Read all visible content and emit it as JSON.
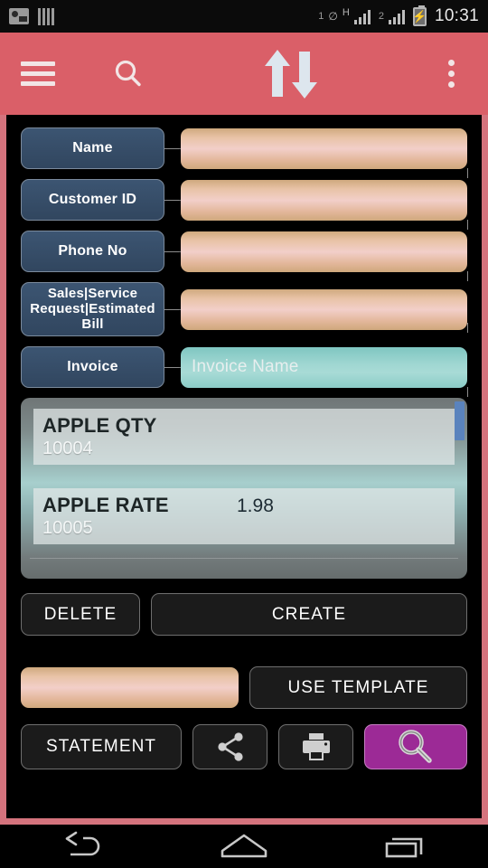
{
  "status_bar": {
    "left_icons": [
      "photo-icon",
      "bars-icon"
    ],
    "sim1_label": "1",
    "network_type": "H",
    "sim2_label": "2",
    "battery_icon": "battery-charging-icon",
    "time": "10:31"
  },
  "app_bar": {
    "background": "#da5f68",
    "menu_icon": "hamburger-menu-icon",
    "search_icon": "search-icon",
    "logo_icon": "sync-arrows-icon",
    "overflow_icon": "overflow-menu-icon"
  },
  "form": {
    "accent_border": "#d4737d",
    "fields": [
      {
        "label": "Name",
        "value": "",
        "placeholder": "",
        "style": "tan",
        "two_line": false
      },
      {
        "label": "Customer ID",
        "value": "",
        "placeholder": "",
        "style": "tan",
        "two_line": false
      },
      {
        "label": "Phone No",
        "value": "",
        "placeholder": "",
        "style": "tan",
        "two_line": false
      },
      {
        "label": "Sales|Service Request|Estimated Bill",
        "value": "",
        "placeholder": "",
        "style": "tan",
        "two_line": true
      },
      {
        "label": "Invoice",
        "value": "",
        "placeholder": "Invoice Name",
        "style": "teal",
        "two_line": false
      }
    ]
  },
  "list": {
    "scrollbar_color": "#5a83bd",
    "items": [
      {
        "title": "APPLE QTY",
        "code": "10004",
        "value": ""
      },
      {
        "title": "APPLE RATE",
        "code": "10005",
        "value": "1.98"
      }
    ]
  },
  "actions": {
    "delete_label": "DELETE",
    "create_label": "CREATE",
    "template_input_value": "",
    "use_template_label": "USE TEMPLATE",
    "statement_label": "STATEMENT",
    "share_icon": "share-icon",
    "print_icon": "print-icon",
    "search_icon": "magnifier-icon",
    "search_button_color": "#9c2a96"
  },
  "nav_bar": {
    "back_icon": "back-arrow-icon",
    "home_icon": "home-icon",
    "recents_icon": "recent-apps-icon"
  }
}
